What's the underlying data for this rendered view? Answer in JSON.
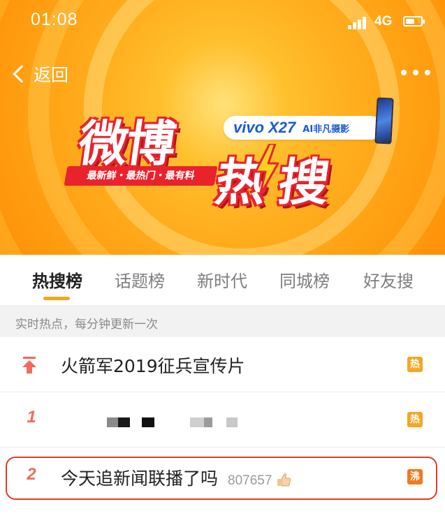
{
  "status_bar": {
    "time": "01:08",
    "network": "4G"
  },
  "nav": {
    "back_label": "返回"
  },
  "banner": {
    "logo_part1": "微博",
    "logo_part2": "热搜",
    "tagline": "最新鲜・最热门・最有料",
    "sponsor_brand": "vivo X27",
    "sponsor_tag": "AI非凡摄影"
  },
  "tabs": [
    {
      "label": "热搜榜",
      "active": true
    },
    {
      "label": "话题榜"
    },
    {
      "label": "新时代"
    },
    {
      "label": "同城榜"
    },
    {
      "label": "好友搜"
    }
  ],
  "subheader": "实时热点，每分钟更新一次",
  "list": [
    {
      "rank": "",
      "pinned": true,
      "title": "火箭军2019征兵宣传片",
      "count": "",
      "badge": "热",
      "badge_color": "#f5a623"
    },
    {
      "rank": "1",
      "title": "",
      "redacted": true,
      "count": "",
      "badge": "热",
      "badge_color": "#f5a623"
    },
    {
      "rank": "2",
      "title": "今天追新闻联播了吗",
      "count": "807657",
      "badge": "沸",
      "badge_color": "#f07a1d",
      "highlighted": true
    }
  ],
  "colors": {
    "accent": "#f5a623",
    "rank": "#f26a5b",
    "highlight_border": "#e53a2c"
  },
  "icons": {
    "back": "chevron-left-icon",
    "more": "more-dots-icon",
    "pin": "pin-top-icon",
    "thumb": "thumbs-up-icon",
    "bolt": "lightning-icon"
  }
}
